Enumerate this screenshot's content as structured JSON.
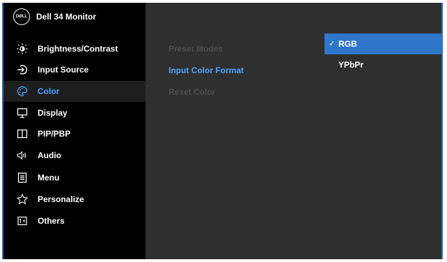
{
  "header": {
    "logo_text": "DØLL",
    "title": "Dell 34 Monitor"
  },
  "menu": [
    {
      "label": "Brightness/Contrast",
      "icon": "brightness-icon",
      "active": false
    },
    {
      "label": "Input Source",
      "icon": "input-source-icon",
      "active": false
    },
    {
      "label": "Color",
      "icon": "color-palette-icon",
      "active": true
    },
    {
      "label": "Display",
      "icon": "display-icon",
      "active": false
    },
    {
      "label": "PIP/PBP",
      "icon": "pip-pbp-icon",
      "active": false
    },
    {
      "label": "Audio",
      "icon": "speaker-icon",
      "active": false
    },
    {
      "label": "Menu",
      "icon": "menu-doc-icon",
      "active": false
    },
    {
      "label": "Personalize",
      "icon": "star-icon",
      "active": false
    },
    {
      "label": "Others",
      "icon": "others-icon",
      "active": false
    }
  ],
  "submenu": [
    {
      "label": "Preset Modes",
      "state": "disabled"
    },
    {
      "label": "Input Color Format",
      "state": "active"
    },
    {
      "label": "Reset Color",
      "state": "disabled"
    }
  ],
  "options": [
    {
      "label": "RGB",
      "selected": true,
      "check": "✓"
    },
    {
      "label": "YPbPr",
      "selected": false
    }
  ],
  "colors": {
    "accent": "#2f76c8",
    "active_text": "#49a6ff",
    "sidebar_bg": "#000000",
    "panel_bg": "#2f2f2f",
    "border": "#2a6db5"
  }
}
